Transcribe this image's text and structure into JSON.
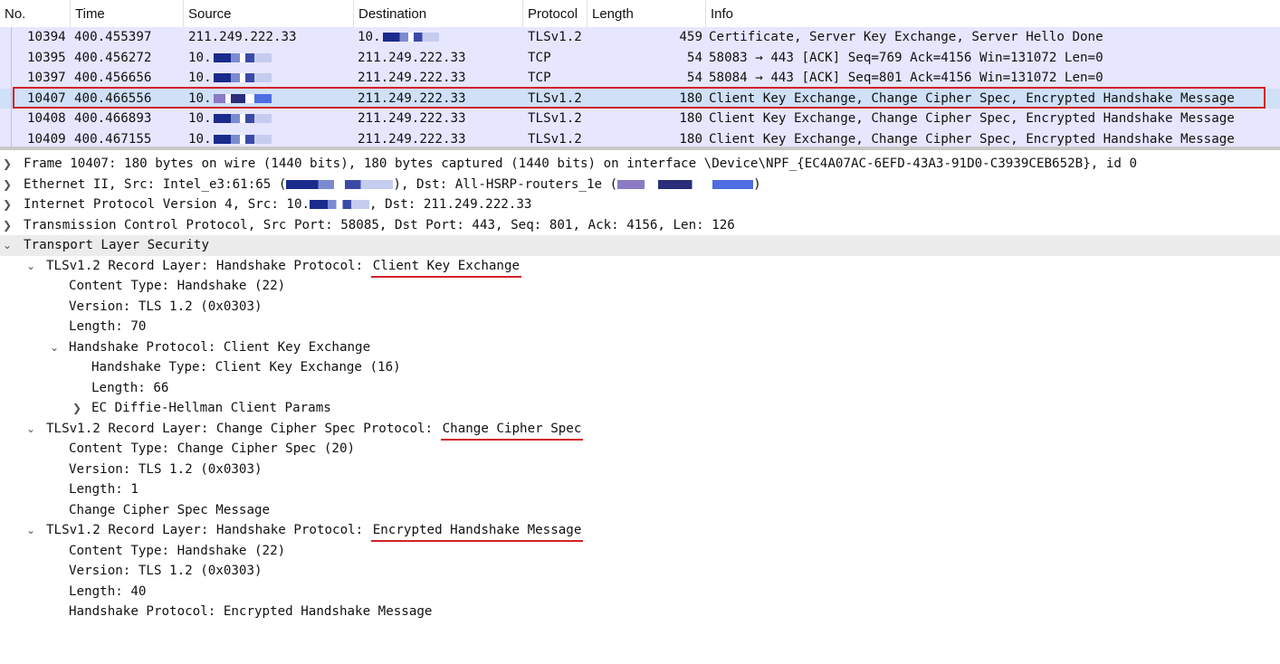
{
  "columns": [
    "No.",
    "Time",
    "Source",
    "Destination",
    "Protocol",
    "Length",
    "Info"
  ],
  "packets": [
    {
      "no": "10394",
      "time": "400.455397",
      "source": "211.249.222.33",
      "destination": "10.",
      "protocol": "TLSv1.2",
      "length": "459",
      "info": "Certificate, Server Key Exchange, Server Hello Done"
    },
    {
      "no": "10395",
      "time": "400.456272",
      "source": "10.",
      "destination": "211.249.222.33",
      "protocol": "TCP",
      "length": "54",
      "info": "58083 → 443 [ACK] Seq=769 Ack=4156 Win=131072 Len=0"
    },
    {
      "no": "10397",
      "time": "400.456656",
      "source": "10.",
      "destination": "211.249.222.33",
      "protocol": "TCP",
      "length": "54",
      "info": "58084 → 443 [ACK] Seq=801 Ack=4156 Win=131072 Len=0"
    },
    {
      "no": "10407",
      "time": "400.466556",
      "source": "10.",
      "destination": "211.249.222.33",
      "protocol": "TLSv1.2",
      "length": "180",
      "info": "Client Key Exchange, Change Cipher Spec, Encrypted Handshake Message"
    },
    {
      "no": "10408",
      "time": "400.466893",
      "source": "10.",
      "destination": "211.249.222.33",
      "protocol": "TLSv1.2",
      "length": "180",
      "info": "Client Key Exchange, Change Cipher Spec, Encrypted Handshake Message"
    },
    {
      "no": "10409",
      "time": "400.467155",
      "source": "10.",
      "destination": "211.249.222.33",
      "protocol": "TLSv1.2",
      "length": "180",
      "info": "Client Key Exchange, Change Cipher Spec, Encrypted Handshake Message"
    }
  ],
  "details": {
    "frame": "Frame 10407: 180 bytes on wire (1440 bits), 180 bytes captured (1440 bits) on interface \\Device\\NPF_{EC4A07AC-6EFD-43A3-91D0-C3939CEB652B}, id 0",
    "ethernet_a": "Ethernet II, Src: Intel_e3:61:65 (",
    "ethernet_b": "), Dst: All-HSRP-routers_1e (",
    "ethernet_c": ")",
    "ip_a": "Internet Protocol Version 4, Src: 10.",
    "ip_b": ", Dst: 211.249.222.33",
    "tcp": "Transmission Control Protocol, Src Port: 58085, Dst Port: 443, Seq: 801, Ack: 4156, Len: 126",
    "tls": "Transport Layer Security",
    "rec1_prefix": "TLSv1.2 Record Layer: Handshake Protocol: ",
    "rec1_name": "Client Key Exchange",
    "rec1_content_type": "Content Type: Handshake (22)",
    "rec1_version": "Version: TLS 1.2 (0x0303)",
    "rec1_length": "Length: 70",
    "hs_protocol": "Handshake Protocol: Client Key Exchange",
    "hs_type": "Handshake Type: Client Key Exchange (16)",
    "hs_length": "Length: 66",
    "ec_params": "EC Diffie-Hellman Client Params",
    "rec2_prefix": "TLSv1.2 Record Layer: Change Cipher Spec Protocol: ",
    "rec2_name": "Change Cipher Spec",
    "rec2_content_type": "Content Type: Change Cipher Spec (20)",
    "rec2_version": "Version: TLS 1.2 (0x0303)",
    "rec2_length": "Length: 1",
    "rec2_msg": "Change Cipher Spec Message",
    "rec3_prefix": "TLSv1.2 Record Layer: Handshake Protocol: ",
    "rec3_name": "Encrypted Handshake Message",
    "rec3_content_type": "Content Type: Handshake (22)",
    "rec3_version": "Version: TLS 1.2 (0x0303)",
    "rec3_length": "Length: 40",
    "rec3_msg": "Handshake Protocol: Encrypted Handshake Message"
  },
  "icons": {
    "collapsed": "chevron-right-icon",
    "expanded": "chevron-down-icon"
  },
  "colors": {
    "row_bg": "#e7e6ff",
    "selected_bg": "#cfe0f7",
    "annotation": "#d32128"
  }
}
